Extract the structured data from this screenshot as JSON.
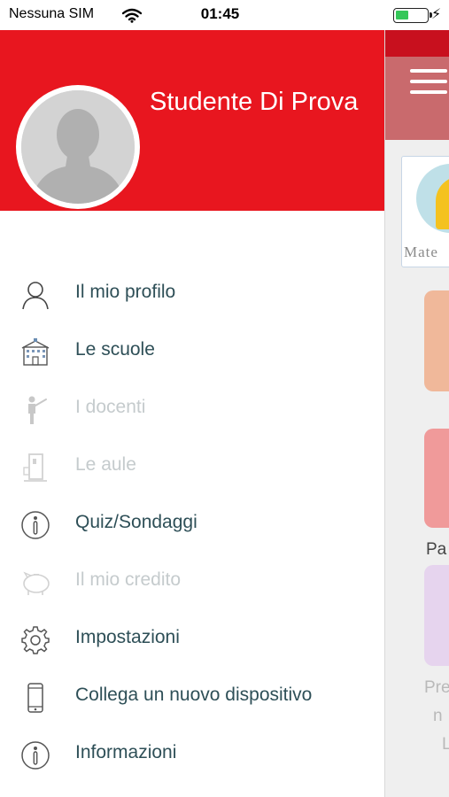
{
  "status_bar": {
    "carrier": "Nessuna SIM",
    "time": "01:45",
    "battery_level": 0.4
  },
  "drawer": {
    "header_color": "#e8161f",
    "user_name": "Studente Di Prova",
    "items": [
      {
        "label": "Il mio profilo",
        "icon": "user-icon",
        "enabled": true
      },
      {
        "label": "Le scuole",
        "icon": "school-building-icon",
        "enabled": true
      },
      {
        "label": "I docenti",
        "icon": "teacher-icon",
        "enabled": false
      },
      {
        "label": "Le aule",
        "icon": "classroom-door-icon",
        "enabled": false
      },
      {
        "label": "Quiz/Sondaggi",
        "icon": "info-icon",
        "enabled": true
      },
      {
        "label": "Il mio credito",
        "icon": "piggy-bank-icon",
        "enabled": false
      },
      {
        "label": "Impostazioni",
        "icon": "gear-icon",
        "enabled": true
      },
      {
        "label": "Collega un nuovo dispositivo",
        "icon": "smartphone-icon",
        "enabled": true
      },
      {
        "label": "Informazioni",
        "icon": "info-icon",
        "enabled": true
      }
    ]
  },
  "background_app": {
    "card_label": "Mate",
    "text_pa": "Pa",
    "text_pre": "Pre",
    "text_n": "n",
    "text_l": "L"
  },
  "colors": {
    "accent": "#e8161f",
    "menu_text": "#2e4f57",
    "menu_text_disabled": "#c5cbcd"
  }
}
